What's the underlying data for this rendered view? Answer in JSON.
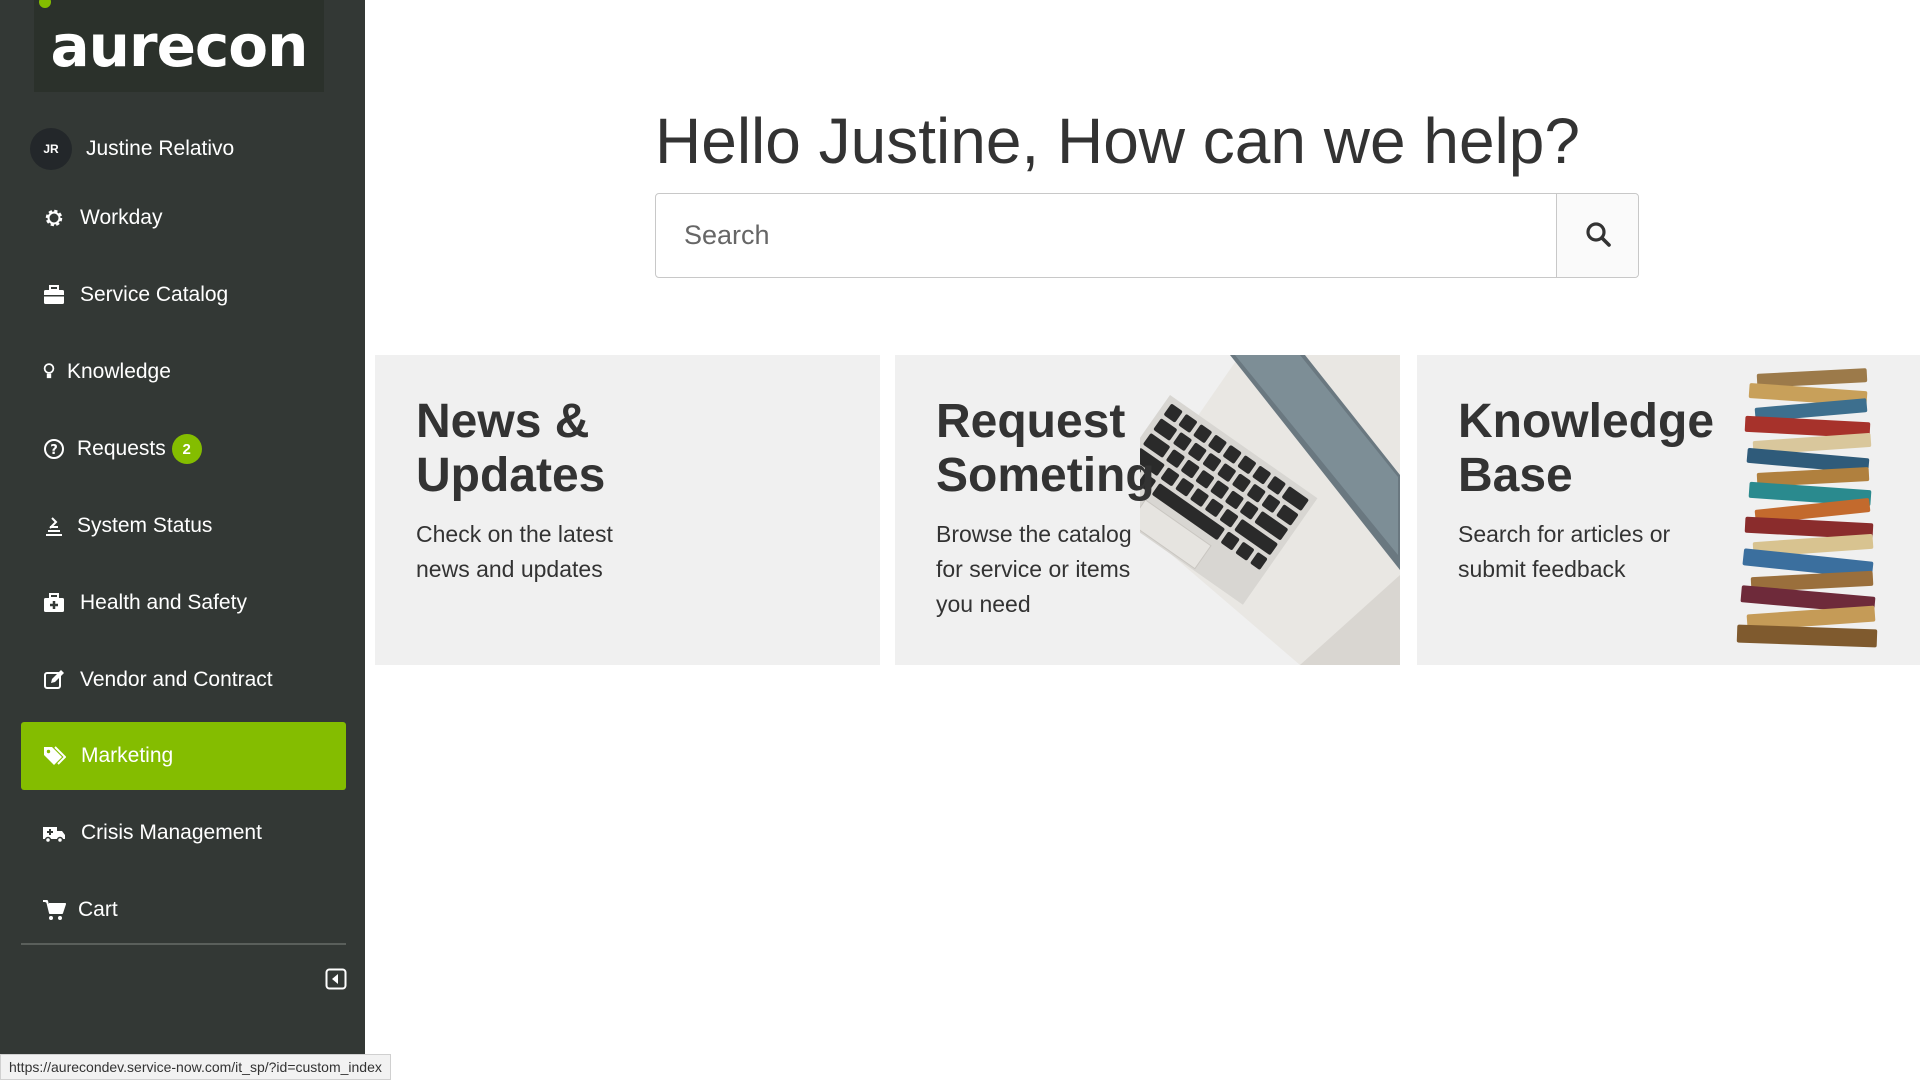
{
  "brand": {
    "logo_text": "aurecon",
    "accent_color": "#84bd00",
    "sidebar_bg": "#333835"
  },
  "user": {
    "initials": "JR",
    "name": "Justine Relativo"
  },
  "nav": {
    "items": [
      {
        "label": "Workday",
        "icon": "gear-icon"
      },
      {
        "label": "Service Catalog",
        "icon": "briefcase-icon"
      },
      {
        "label": "Knowledge",
        "icon": "lightbulb-icon"
      },
      {
        "label": "Requests",
        "icon": "question-circle-icon",
        "badge": "2"
      },
      {
        "label": "System Status",
        "icon": "status-icon"
      },
      {
        "label": "Health and Safety",
        "icon": "medkit-icon"
      },
      {
        "label": "Vendor and Contract",
        "icon": "edit-icon"
      },
      {
        "label": "Marketing",
        "icon": "tags-icon",
        "active": true
      },
      {
        "label": "Crisis Management",
        "icon": "ambulance-icon"
      },
      {
        "label": "Cart",
        "icon": "cart-icon"
      }
    ]
  },
  "main": {
    "greeting": "Hello Justine, How can we help?",
    "search": {
      "placeholder": "Search"
    }
  },
  "cards": [
    {
      "title": "News & Updates",
      "description": "Check on the latest news and updates"
    },
    {
      "title": "Request Someting",
      "description": "Browse the catalog for service or items you need"
    },
    {
      "title": "Knowledge Base",
      "description": "Search for articles or submit feedback"
    }
  ],
  "status_bar": {
    "url": "https://aurecondev.service-now.com/it_sp/?id=custom_index"
  }
}
